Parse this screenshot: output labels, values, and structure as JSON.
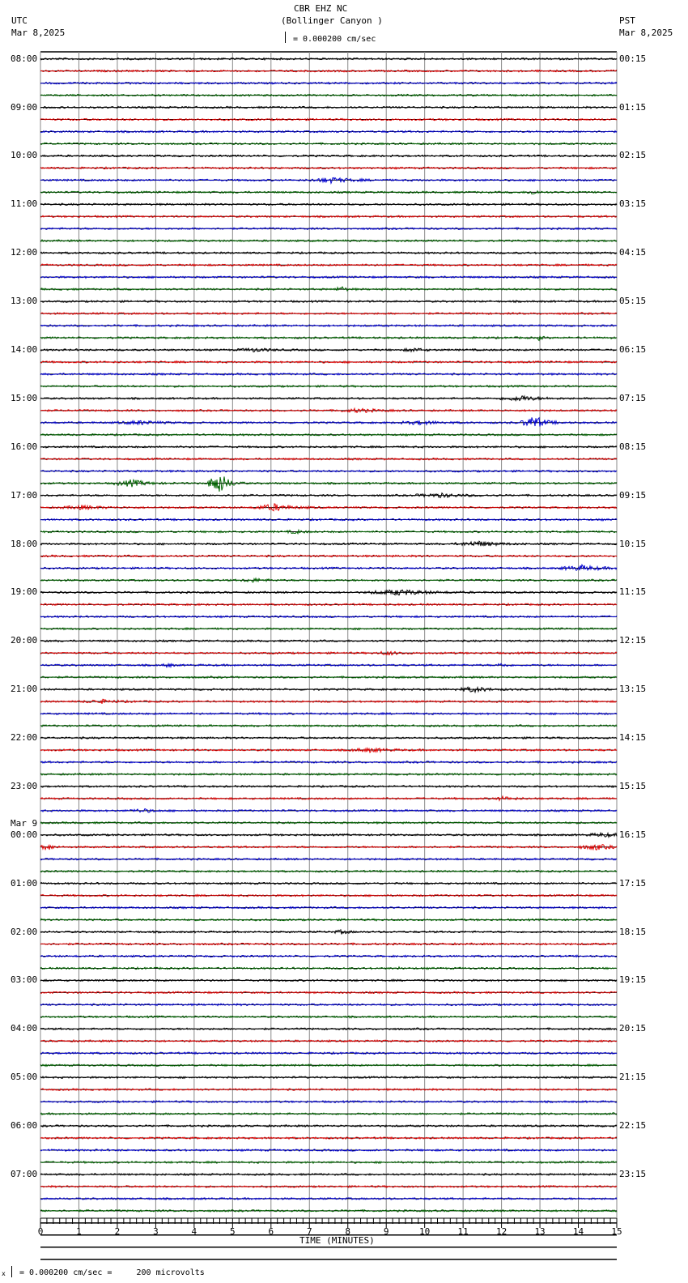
{
  "header": {
    "title": "CBR EHZ NC",
    "subtitle": "(Bollinger Canyon )",
    "scale": "= 0.000200 cm/sec",
    "left_tz": "UTC",
    "left_date": "Mar 8,2025",
    "right_tz": "PST",
    "right_date": "Mar 8,2025"
  },
  "footer": {
    "scale_note": "= 0.000200 cm/sec =     200 microvolts",
    "prefix": "x"
  },
  "chart_data": {
    "type": "line",
    "title": "CBR EHZ NC (Bollinger Canyon )",
    "xlabel": "TIME (MINUTES)",
    "xlim": [
      0,
      15
    ],
    "x_ticks": [
      "0",
      "1",
      "2",
      "3",
      "4",
      "5",
      "6",
      "7",
      "8",
      "9",
      "10",
      "11",
      "12",
      "13",
      "14",
      "15"
    ],
    "trace_colors": [
      "#000000",
      "#e00000",
      "#0000d0",
      "#006400"
    ],
    "trace_count": 100,
    "data_trace_count": 96,
    "left_labels": [
      "08:00",
      "09:00",
      "10:00",
      "11:00",
      "12:00",
      "13:00",
      "14:00",
      "15:00",
      "16:00",
      "17:00",
      "18:00",
      "19:00",
      "20:00",
      "21:00",
      "22:00",
      "23:00",
      "00:00",
      "01:00",
      "02:00",
      "03:00",
      "04:00",
      "05:00",
      "06:00",
      "07:00"
    ],
    "date_change_label": "Mar 9",
    "right_labels": [
      "00:15",
      "01:15",
      "02:15",
      "03:15",
      "04:15",
      "05:15",
      "06:15",
      "07:15",
      "08:15",
      "09:15",
      "10:15",
      "11:15",
      "12:15",
      "13:15",
      "14:15",
      "15:15",
      "16:15",
      "17:15",
      "18:15",
      "19:15",
      "20:15",
      "21:15",
      "22:15",
      "23:15"
    ],
    "events": [
      {
        "trace": 10,
        "minute": 7.5,
        "duration": 1.0,
        "amp": 3
      },
      {
        "trace": 11,
        "minute": 12.8,
        "duration": 0.3,
        "amp": 3
      },
      {
        "trace": 19,
        "minute": 7.8,
        "duration": 0.3,
        "amp": 3
      },
      {
        "trace": 23,
        "minute": 13.0,
        "duration": 0.1,
        "amp": 5
      },
      {
        "trace": 24,
        "minute": 5.5,
        "duration": 0.8,
        "amp": 2
      },
      {
        "trace": 24,
        "minute": 9.7,
        "duration": 0.5,
        "amp": 2
      },
      {
        "trace": 28,
        "minute": 12.4,
        "duration": 1.0,
        "amp": 3
      },
      {
        "trace": 29,
        "minute": 8.2,
        "duration": 1.0,
        "amp": 2
      },
      {
        "trace": 30,
        "minute": 2.5,
        "duration": 1.0,
        "amp": 2
      },
      {
        "trace": 30,
        "minute": 9.8,
        "duration": 1.0,
        "amp": 2
      },
      {
        "trace": 30,
        "minute": 12.8,
        "duration": 0.6,
        "amp": 8
      },
      {
        "trace": 35,
        "minute": 2.3,
        "duration": 0.8,
        "amp": 4
      },
      {
        "trace": 35,
        "minute": 4.6,
        "duration": 0.5,
        "amp": 14
      },
      {
        "trace": 36,
        "minute": 10.3,
        "duration": 1.2,
        "amp": 2
      },
      {
        "trace": 37,
        "minute": 6.0,
        "duration": 0.9,
        "amp": 4
      },
      {
        "trace": 37,
        "minute": 1.0,
        "duration": 1.0,
        "amp": 2
      },
      {
        "trace": 39,
        "minute": 6.6,
        "duration": 0.4,
        "amp": 2
      },
      {
        "trace": 40,
        "minute": 11.3,
        "duration": 1.0,
        "amp": 3
      },
      {
        "trace": 42,
        "minute": 14.0,
        "duration": 1.0,
        "amp": 3
      },
      {
        "trace": 43,
        "minute": 5.5,
        "duration": 0.6,
        "amp": 2
      },
      {
        "trace": 44,
        "minute": 9.2,
        "duration": 1.5,
        "amp": 3
      },
      {
        "trace": 49,
        "minute": 9.0,
        "duration": 0.6,
        "amp": 2
      },
      {
        "trace": 50,
        "minute": 3.3,
        "duration": 0.2,
        "amp": 3
      },
      {
        "trace": 50,
        "minute": 12.0,
        "duration": 0.2,
        "amp": 3
      },
      {
        "trace": 52,
        "minute": 11.2,
        "duration": 0.8,
        "amp": 3
      },
      {
        "trace": 53,
        "minute": 1.5,
        "duration": 0.8,
        "amp": 2
      },
      {
        "trace": 57,
        "minute": 8.5,
        "duration": 1.0,
        "amp": 2
      },
      {
        "trace": 61,
        "minute": 12.0,
        "duration": 0.6,
        "amp": 2
      },
      {
        "trace": 62,
        "minute": 2.6,
        "duration": 0.6,
        "amp": 2
      },
      {
        "trace": 64,
        "minute": 14.6,
        "duration": 0.8,
        "amp": 2
      },
      {
        "trace": 65,
        "minute": 0.15,
        "duration": 0.3,
        "amp": 4
      },
      {
        "trace": 65,
        "minute": 14.4,
        "duration": 0.8,
        "amp": 3
      },
      {
        "trace": 72,
        "minute": 7.8,
        "duration": 0.4,
        "amp": 2
      },
      {
        "trace": 75,
        "minute": 9.3,
        "duration": 0.05,
        "amp": 4
      }
    ]
  }
}
